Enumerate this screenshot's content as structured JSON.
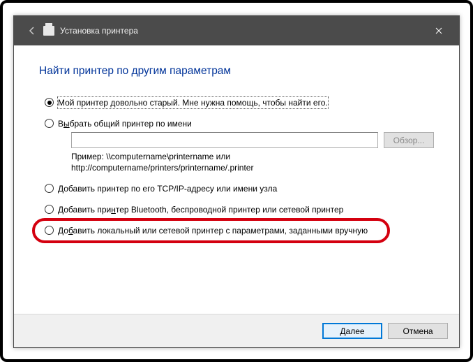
{
  "titlebar": {
    "title": "Установка принтера"
  },
  "heading": "Найти принтер по другим параметрам",
  "options": {
    "old_printer": "Мой принтер довольно старый. Мне нужна помощь, чтобы найти его.",
    "shared_label": "Выбрать общий принтер по имени",
    "browse_btn": "Обзор...",
    "example_line1": "Пример: \\\\computername\\printername или",
    "example_line2": "http://computername/printers/printername/.printer",
    "tcpip": "Добавить принтер по его TCP/IP-адресу или имени узла",
    "bluetooth": "Добавить принтер Bluetooth, беспроводной принтер или сетевой принтер",
    "manual": "Добавить локальный или сетевой принтер с параметрами, заданными вручную"
  },
  "footer": {
    "next": "Далее",
    "cancel": "Отмена"
  }
}
